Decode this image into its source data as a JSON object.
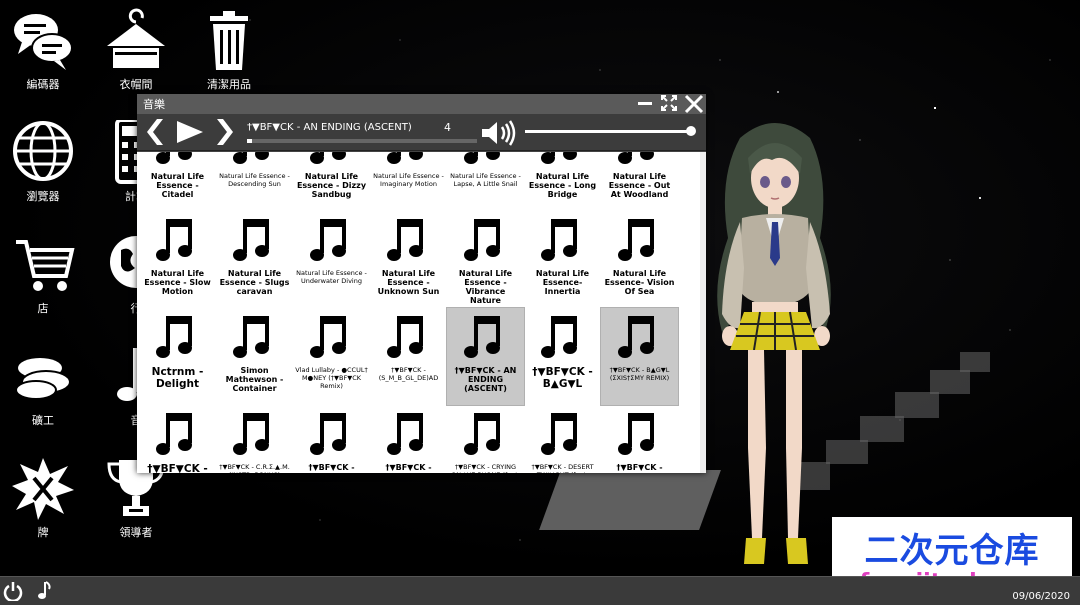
{
  "desktop_icons": [
    {
      "label": "編碼器",
      "icon": "chat-bubbles-icon"
    },
    {
      "label": "衣帽間",
      "icon": "hanger-icon"
    },
    {
      "label": "清潔用品",
      "icon": "trash-icon"
    },
    {
      "label": "瀏覽器",
      "icon": "globe-icon"
    },
    {
      "label": "計算",
      "icon": "calculator-icon"
    },
    {
      "label": "店",
      "icon": "cart-icon"
    },
    {
      "label": "行",
      "icon": "world-icon"
    },
    {
      "label": "礦工",
      "icon": "coins-icon"
    },
    {
      "label": "音",
      "icon": "music-note-icon"
    },
    {
      "label": "牌",
      "icon": "card-burst-icon"
    },
    {
      "label": "領導者",
      "icon": "trophy-icon"
    }
  ],
  "window": {
    "title": "音樂",
    "buttons": [
      "minimize",
      "fullscreen",
      "close"
    ]
  },
  "player": {
    "current_track": "†▼BF▼CK - AN ENDING (ASCENT)",
    "track_number": "4",
    "seek_progress": 0.02,
    "volume": 1.0
  },
  "tracks": [
    {
      "name": "Natural Life Essence - Citadel",
      "size": "normal"
    },
    {
      "name": "Natural Life Essence - Descending Sun",
      "size": "small"
    },
    {
      "name": "Natural Life Essence - Dizzy Sandbug",
      "size": "normal"
    },
    {
      "name": "Natural Life Essence - Imaginary Motion",
      "size": "small"
    },
    {
      "name": "Natural Life Essence - Lapse, A Little Snail",
      "size": "small"
    },
    {
      "name": "Natural Life Essence - Long Bridge",
      "size": "normal"
    },
    {
      "name": "Natural Life Essence - Out At Woodland",
      "size": "normal"
    },
    {
      "name": "Natural Life Essence - Slow Motion",
      "size": "normal"
    },
    {
      "name": "Natural Life Essence - Slugs caravan",
      "size": "normal"
    },
    {
      "name": "Natural Life Essence - Underwater Diving",
      "size": "small"
    },
    {
      "name": "Natural Life Essence - Unknown Sun",
      "size": "normal"
    },
    {
      "name": "Natural Life Essence - Vibrance Nature",
      "size": "normal"
    },
    {
      "name": "Natural Life Essence- Innertia",
      "size": "normal"
    },
    {
      "name": "Natural Life Essence- Vision Of Sea",
      "size": "normal"
    },
    {
      "name": "Nctrnm - Delight",
      "size": "big"
    },
    {
      "name": "Simon Mathewson - Container",
      "size": "normal"
    },
    {
      "name": "Vlad Lullaby - ●CCUL† M●NEY (†▼BF▼CK Remix)",
      "size": "small"
    },
    {
      "name": "†▼BF▼CK - (S_M_B_GL_DE)AD",
      "size": "small"
    },
    {
      "name": "†▼BF▼CK - AN ENDING (ASCENT)",
      "size": "normal",
      "selected": true
    },
    {
      "name": "†▼BF▼CK - B▲G▼L",
      "size": "big"
    },
    {
      "name": "†▼BF▼CK - B▲G▼L (ΣXIS†ΣMY REMIX)",
      "size": "small",
      "selected": true
    },
    {
      "name": "†▼BF▼CK - C.R.Σ.▲.M.",
      "size": "big"
    },
    {
      "name": "†▼BF▼CK - C.R.Σ.▲.M. (INSTR. BONUS)",
      "size": "small"
    },
    {
      "name": "†▼BF▼CK - CABIN IN THE WOODS",
      "size": "normal"
    },
    {
      "name": "†▼BF▼CK - CLOSER (feat. Aaron Sarrel)",
      "size": "normal"
    },
    {
      "name": "†▼BF▼CK - CRYING ON †HΣ PHONΣ (feat. Vlad",
      "size": "small"
    },
    {
      "name": "†▼BF▼CK - DESERT TWILIGHT (feat.",
      "size": "small"
    },
    {
      "name": "†▼BF▼CK - DIS†▲NCΣ",
      "size": "normal"
    }
  ],
  "taskbar": {
    "date": "09/06/2020"
  },
  "watermark": {
    "line1": "二次元仓库",
    "line2": "fengjitech.com"
  },
  "colors": {
    "window_bg": "#444444",
    "list_bg": "#ffffff",
    "selected_bg": "#c8c8c8",
    "watermark_blue": "#1a4be0",
    "watermark_pink": "#e040c0"
  }
}
